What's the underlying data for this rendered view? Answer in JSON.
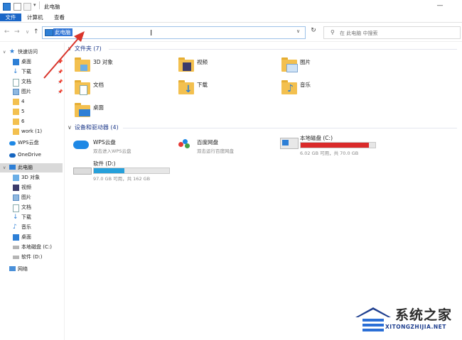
{
  "window": {
    "title": "此电脑"
  },
  "ribbon": {
    "tabs": [
      "文件",
      "计算机",
      "查看"
    ]
  },
  "address": {
    "path": "此电脑",
    "search_placeholder": "在 此电脑 中搜索"
  },
  "sidebar": {
    "quick_access": "快速访问",
    "quick_items": [
      "桌面",
      "下载",
      "文档",
      "图片",
      "4",
      "5",
      "6",
      "work (1)"
    ],
    "wps_cloud": "WPS云盘",
    "onedrive": "OneDrive",
    "this_pc": "此电脑",
    "pc_items": [
      "3D 对象",
      "视频",
      "图片",
      "文档",
      "下载",
      "音乐",
      "桌面",
      "本地磁盘 (C:)",
      "软件 (D:)"
    ],
    "network": "网络"
  },
  "content": {
    "folders_header": "文件夹 (7)",
    "folders": [
      "3D 对象",
      "视频",
      "图片",
      "文档",
      "下载",
      "音乐",
      "桌面"
    ],
    "devices_header": "设备和驱动器 (4)",
    "devices": [
      {
        "name": "WPS云盘",
        "sub": "双击进入WPS云盘"
      },
      {
        "name": "百度网盘",
        "sub": "双击运行百度网盘"
      },
      {
        "name": "本地磁盘 (C:)",
        "sub": "6.02 GB 可用，共 70.0 GB",
        "used_fraction": 0.914,
        "bar_color": "#da2a2a"
      },
      {
        "name": "软件 (D:)",
        "sub": "97.0 GB 可用，共 162 GB",
        "used_fraction": 0.401,
        "bar_color": "#26a0da"
      }
    ]
  },
  "watermark": {
    "name": "系统之家",
    "url": "XITONGZHIJIA.NET"
  },
  "colors": {
    "accent": "#1a66c7",
    "selection": "#3578d7",
    "folder": "#f3c04f",
    "arrow": "#d9342b"
  }
}
